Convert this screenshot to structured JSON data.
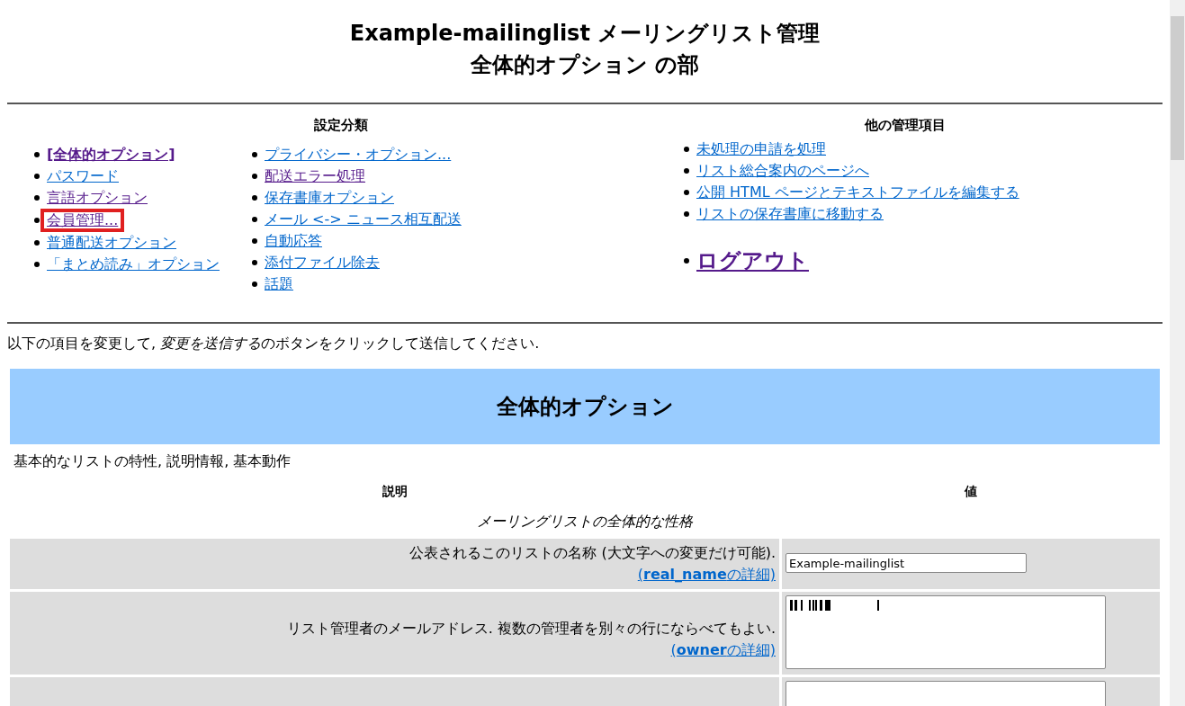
{
  "title_lines": [
    "Example-mailinglist メーリングリスト管理",
    "全体的オプション の部"
  ],
  "categories": {
    "heading": "設定分類",
    "columns": [
      [
        {
          "label": "[全体的オプション]",
          "current": true,
          "visited": true,
          "highlighted": false
        },
        {
          "label": "パスワード",
          "current": false,
          "visited": false,
          "highlighted": false
        },
        {
          "label": "言語オプション",
          "current": false,
          "visited": true,
          "highlighted": false
        },
        {
          "label": "会員管理...",
          "current": false,
          "visited": true,
          "highlighted": true
        },
        {
          "label": "普通配送オプション",
          "current": false,
          "visited": false,
          "highlighted": false
        },
        {
          "label": "「まとめ読み」オプション",
          "current": false,
          "visited": false,
          "highlighted": false
        }
      ],
      [
        {
          "label": "プライバシー・オプション...",
          "current": false,
          "visited": false,
          "highlighted": false
        },
        {
          "label": "配送エラー処理",
          "current": false,
          "visited": true,
          "highlighted": false
        },
        {
          "label": "保存書庫オプション",
          "current": false,
          "visited": false,
          "highlighted": false
        },
        {
          "label": "メール <-> ニュース相互配送",
          "current": false,
          "visited": false,
          "highlighted": false
        },
        {
          "label": "自動応答",
          "current": false,
          "visited": false,
          "highlighted": false
        },
        {
          "label": "添付ファイル除去",
          "current": false,
          "visited": false,
          "highlighted": false
        },
        {
          "label": "話題",
          "current": false,
          "visited": false,
          "highlighted": false
        }
      ]
    ]
  },
  "other": {
    "heading": "他の管理項目",
    "items": [
      {
        "label": "未処理の申請を処理",
        "visited": false
      },
      {
        "label": "リスト総合案内のページへ",
        "visited": false
      },
      {
        "label": "公開 HTML ページとテキストファイルを編集する",
        "visited": false
      },
      {
        "label": "リストの保存書庫に移動する",
        "visited": false
      }
    ],
    "logout": {
      "label": "ログアウト",
      "visited": true
    }
  },
  "instruction": {
    "before": "以下の項目を変更して, ",
    "emphasis": "変更を送信する",
    "after": "のボタンをクリックして送信してください."
  },
  "section": {
    "title": "全体的オプション",
    "subtitle": "基本的なリストの特性, 説明情報, 基本動作",
    "columns": [
      "説明",
      "値"
    ],
    "group": "メーリングリストの全体的な性格",
    "rows": [
      {
        "kind": "input",
        "description": "公表されるこのリストの名称 (大文字への変更だけ可能).",
        "detail_name": "real_name",
        "detail_suffix": "の詳細)",
        "detail_prefix": "(",
        "value": "Example-mailinglist"
      },
      {
        "kind": "textarea",
        "description": "リスト管理者のメールアドレス. 複数の管理者を別々の行にならべてもよい.",
        "detail_name": "owner",
        "detail_suffix": "の詳細)",
        "detail_prefix": "(",
        "redacted": true
      },
      {
        "kind": "textarea",
        "redacted": false
      }
    ]
  }
}
